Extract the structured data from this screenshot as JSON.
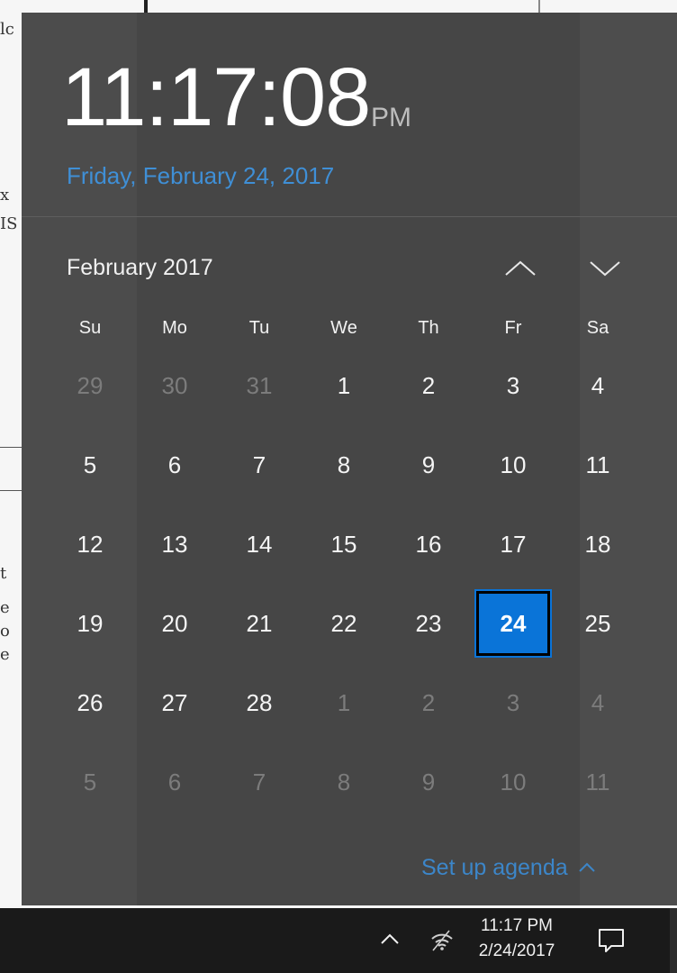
{
  "clock": {
    "time": "11:17:08",
    "ampm": "PM",
    "date": "Friday, February 24, 2017"
  },
  "calendar": {
    "month_label": "February 2017",
    "weekdays": [
      "Su",
      "Mo",
      "Tu",
      "We",
      "Th",
      "Fr",
      "Sa"
    ],
    "weeks": [
      [
        {
          "d": "29",
          "other": true
        },
        {
          "d": "30",
          "other": true
        },
        {
          "d": "31",
          "other": true
        },
        {
          "d": "1"
        },
        {
          "d": "2"
        },
        {
          "d": "3"
        },
        {
          "d": "4"
        }
      ],
      [
        {
          "d": "5"
        },
        {
          "d": "6"
        },
        {
          "d": "7"
        },
        {
          "d": "8"
        },
        {
          "d": "9"
        },
        {
          "d": "10"
        },
        {
          "d": "11"
        }
      ],
      [
        {
          "d": "12"
        },
        {
          "d": "13"
        },
        {
          "d": "14"
        },
        {
          "d": "15"
        },
        {
          "d": "16"
        },
        {
          "d": "17"
        },
        {
          "d": "18"
        }
      ],
      [
        {
          "d": "19"
        },
        {
          "d": "20"
        },
        {
          "d": "21"
        },
        {
          "d": "22"
        },
        {
          "d": "23"
        },
        {
          "d": "24",
          "today": true
        },
        {
          "d": "25"
        }
      ],
      [
        {
          "d": "26"
        },
        {
          "d": "27"
        },
        {
          "d": "28"
        },
        {
          "d": "1",
          "other": true
        },
        {
          "d": "2",
          "other": true
        },
        {
          "d": "3",
          "other": true
        },
        {
          "d": "4",
          "other": true
        }
      ],
      [
        {
          "d": "5",
          "other": true
        },
        {
          "d": "6",
          "other": true
        },
        {
          "d": "7",
          "other": true
        },
        {
          "d": "8",
          "other": true
        },
        {
          "d": "9",
          "other": true
        },
        {
          "d": "10",
          "other": true
        },
        {
          "d": "11",
          "other": true
        }
      ]
    ],
    "nav_icons": {
      "prev": "chevron-up-icon",
      "next": "chevron-down-icon"
    }
  },
  "agenda": {
    "label": "Set up agenda"
  },
  "taskbar": {
    "time": "11:17 PM",
    "date": "2/24/2017",
    "icons": [
      "chevron-up-icon",
      "wifi-icon",
      "action-center-icon"
    ]
  },
  "background_fragments": [
    "lc",
    "x",
    "IS",
    "t",
    "e",
    "o",
    "e"
  ],
  "colors": {
    "flyout_bg": "#464646",
    "accent": "#0a74d8",
    "link": "#3f8fd6",
    "taskbar_bg": "#1a1a1a",
    "muted_day": "#7c7c7c"
  }
}
